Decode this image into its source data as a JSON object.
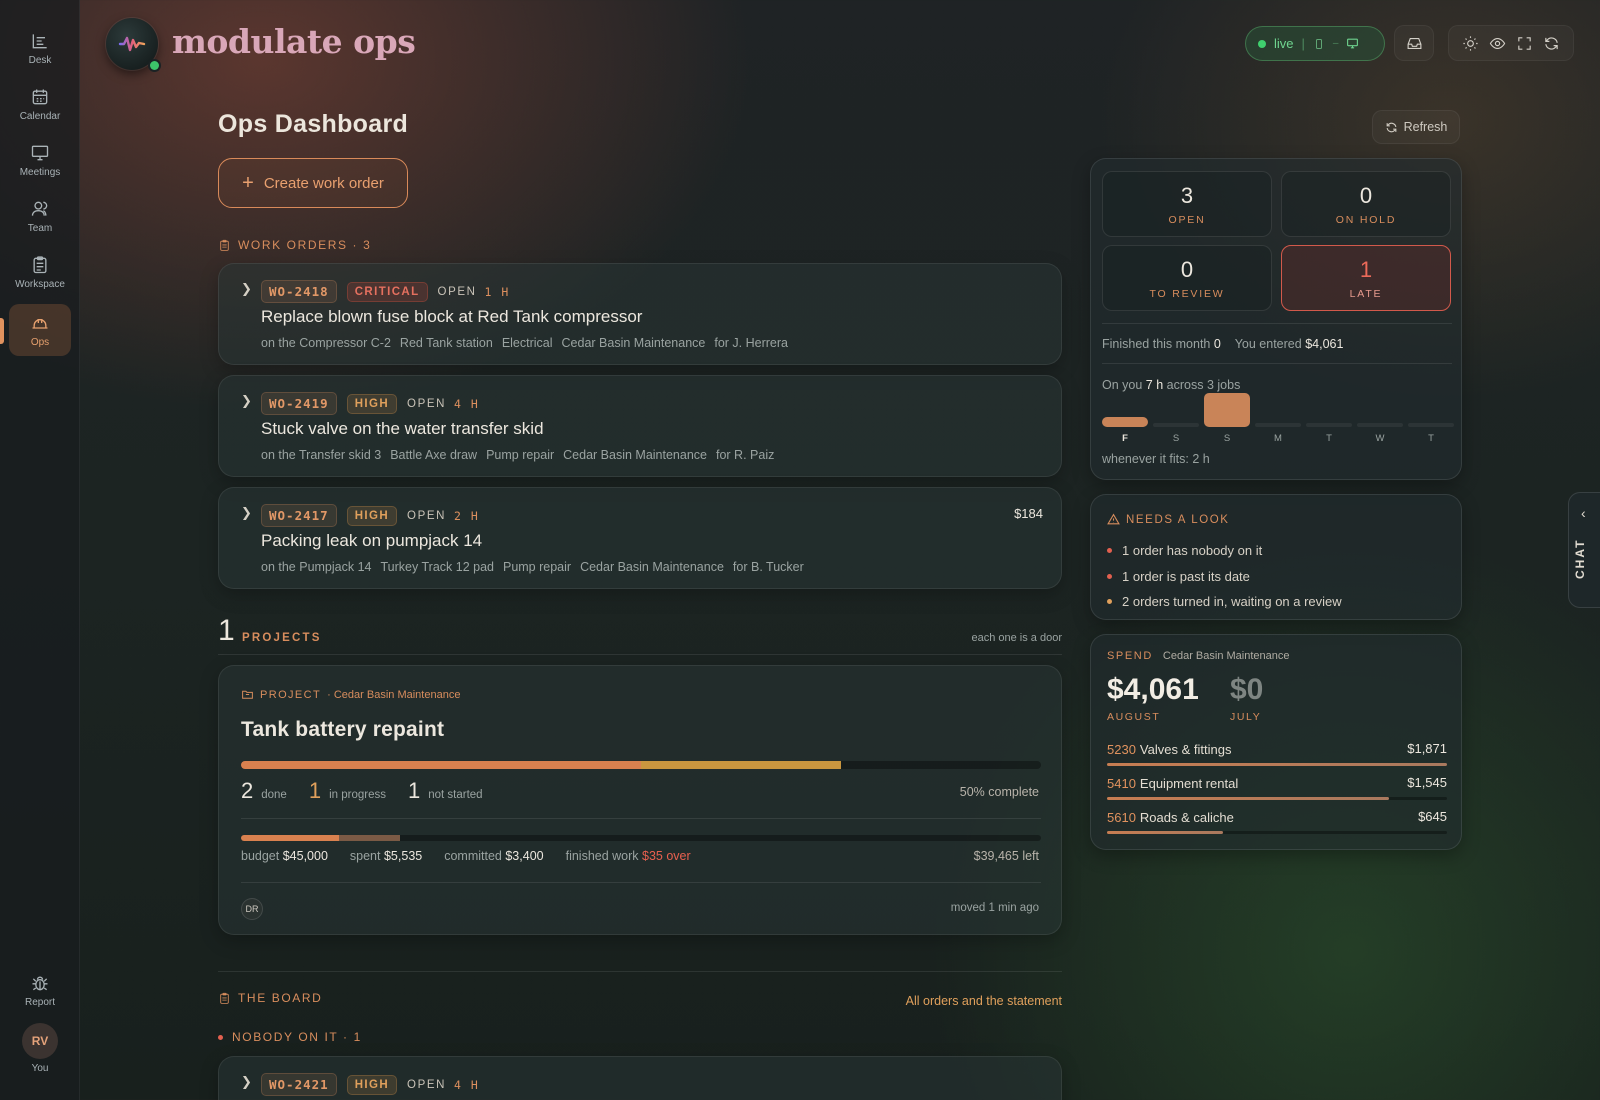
{
  "app": {
    "brand": "modulate ops"
  },
  "sidebar": {
    "items": [
      {
        "label": "Desk",
        "icon": "desk-icon"
      },
      {
        "label": "Calendar",
        "icon": "calendar-icon"
      },
      {
        "label": "Meetings",
        "icon": "presentation-icon"
      },
      {
        "label": "Team",
        "icon": "users-icon"
      },
      {
        "label": "Workspace",
        "icon": "clipboard-icon"
      },
      {
        "label": "Ops",
        "icon": "hard-hat-icon",
        "active": true
      }
    ],
    "report": {
      "label": "Report",
      "icon": "bug-icon"
    },
    "user": {
      "initials": "RV",
      "label": "You"
    }
  },
  "header": {
    "live_label": "live",
    "status_color": "#3fd06e"
  },
  "main": {
    "title": "Ops Dashboard",
    "create_label": "Create work order",
    "work_orders_label": "WORK ORDERS · 3",
    "work_orders": [
      {
        "id": "WO-2418",
        "priority": "CRITICAL",
        "status": "OPEN",
        "age": "1 H",
        "title": "Replace blown fuse block at Red Tank compressor",
        "meta": [
          "on the Compressor C-2",
          "Red Tank station",
          "Electrical",
          "Cedar Basin Maintenance",
          "for J. Herrera"
        ],
        "amount": ""
      },
      {
        "id": "WO-2419",
        "priority": "HIGH",
        "status": "OPEN",
        "age": "4 H",
        "title": "Stuck valve on the water transfer skid",
        "meta": [
          "on the Transfer skid 3",
          "Battle Axe draw",
          "Pump repair",
          "Cedar Basin Maintenance",
          "for R. Paiz"
        ],
        "amount": ""
      },
      {
        "id": "WO-2417",
        "priority": "HIGH",
        "status": "OPEN",
        "age": "2 H",
        "title": "Packing leak on pumpjack 14",
        "meta": [
          "on the Pumpjack 14",
          "Turkey Track 12 pad",
          "Pump repair",
          "Cedar Basin Maintenance",
          "for B. Tucker"
        ],
        "amount": "$184"
      }
    ],
    "projects": {
      "count": "1",
      "label": "PROJECTS",
      "note": "each one is a door",
      "card": {
        "kicker": "PROJECT",
        "org": "· Cedar Basin Maintenance",
        "title": "Tank battery repaint",
        "progress": {
          "done": 2,
          "in_progress": 1,
          "not_started": 1,
          "done_fraction": 0.5,
          "in_progress_fraction": 0.25
        },
        "done_label": "done",
        "in_progress_label": "in progress",
        "not_started_label": "not started",
        "percent_label": "50% complete",
        "budget_fraction_spent": 0.123,
        "budget_fraction_committed": 0.076,
        "budget_label": "budget",
        "budget": "$45,000",
        "spent_label": "spent",
        "spent": "$5,535",
        "committed_label": "committed",
        "committed": "$3,400",
        "finished_label": "finished work",
        "finished": "$35 over",
        "left": "$39,465 left",
        "assignee": "DR",
        "moved": "moved 1 min ago"
      }
    },
    "board": {
      "label": "THE BOARD",
      "link": "All orders and the statement",
      "nobody_label": "NOBODY ON IT · 1",
      "first_order": {
        "id": "WO-2421",
        "priority": "HIGH",
        "status": "OPEN",
        "age": "4 H"
      }
    }
  },
  "right": {
    "refresh_label": "Refresh",
    "stats": [
      {
        "value": "3",
        "label": "OPEN"
      },
      {
        "value": "0",
        "label": "ON HOLD"
      },
      {
        "value": "0",
        "label": "TO REVIEW"
      },
      {
        "value": "1",
        "label": "LATE"
      }
    ],
    "finished_label": "Finished this month",
    "finished_value": "0",
    "entered_label": "You entered",
    "entered_value": "$4,061",
    "load_prefix": "On you",
    "load_hours": "7 h",
    "load_suffix": "across 3 jobs",
    "days": [
      {
        "d": "F",
        "hours": 1.5,
        "current": true
      },
      {
        "d": "S",
        "hours": 0
      },
      {
        "d": "S",
        "hours": 5.5
      },
      {
        "d": "M",
        "hours": 0
      },
      {
        "d": "T",
        "hours": 0
      },
      {
        "d": "W",
        "hours": 0
      },
      {
        "d": "T",
        "hours": 0
      }
    ],
    "fits_label": "whenever it fits: 2 h",
    "needs": {
      "title": "NEEDS A LOOK",
      "items": [
        {
          "text": "1 order has nobody on it",
          "color": "#e2604f"
        },
        {
          "text": "1 order is past its date",
          "color": "#e2604f"
        },
        {
          "text": "2 orders turned in, waiting on a review",
          "color": "#e0a05c"
        }
      ]
    },
    "spend": {
      "label": "SPEND",
      "org": "Cedar Basin Maintenance",
      "current_amount": "$4,061",
      "current_month": "AUGUST",
      "prev_amount": "$0",
      "prev_month": "JULY",
      "categories": [
        {
          "code": "5230",
          "name": "Valves & fittings",
          "amount": "$1,871",
          "fraction": 1.0
        },
        {
          "code": "5410",
          "name": "Equipment rental",
          "amount": "$1,545",
          "fraction": 0.83
        },
        {
          "code": "5610",
          "name": "Roads & caliche",
          "amount": "$645",
          "fraction": 0.34
        }
      ]
    },
    "chat_label": "CHAT"
  }
}
